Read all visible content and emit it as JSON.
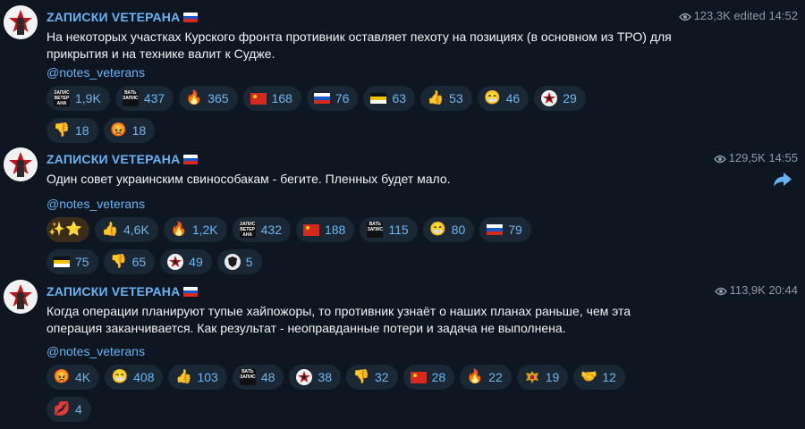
{
  "posts": [
    {
      "channel": "ZАПИСКИ VЕТЕРАНА",
      "views": "123,3K",
      "edited": "edited",
      "time": "14:52",
      "text": "На некоторых участках Курского фронта противник оставляет пехоту на позициях (в основном из ТРО) для прикрытия и на технике валит к Судже.",
      "link": "@notes_veterans",
      "reactions": [
        {
          "icon": "skull-sticker-icon",
          "count": "1,9K"
        },
        {
          "icon": "sticker-text-icon",
          "count": "437"
        },
        {
          "icon": "fire-icon",
          "count": "365"
        },
        {
          "icon": "red-flag-icon",
          "count": "168"
        },
        {
          "icon": "russia-flag-icon",
          "count": "76"
        },
        {
          "icon": "imperial-flag-icon",
          "count": "63"
        },
        {
          "icon": "thumbs-up-icon",
          "count": "53"
        },
        {
          "icon": "grin-icon",
          "count": "46"
        },
        {
          "icon": "star-soldier-icon",
          "count": "29"
        },
        {
          "icon": "thumbs-down-icon",
          "count": "18"
        },
        {
          "icon": "angry-face-icon",
          "count": "18"
        }
      ]
    },
    {
      "channel": "ZАПИСКИ VЕТЕРАНА",
      "views": "129,5K",
      "edited": "",
      "time": "14:55",
      "text": "Один совет украинским свинособакам - бегите. Пленных будет мало.",
      "link": "@notes_veterans",
      "reactions": [
        {
          "icon": "sparkle-star-icon",
          "count": ""
        },
        {
          "icon": "thumbs-up-icon",
          "count": "4,6K"
        },
        {
          "icon": "fire-icon",
          "count": "1,2K"
        },
        {
          "icon": "skull-sticker-icon",
          "count": "432"
        },
        {
          "icon": "red-flag-icon",
          "count": "188"
        },
        {
          "icon": "sticker-text-icon",
          "count": "115"
        },
        {
          "icon": "grin-icon",
          "count": "80"
        },
        {
          "icon": "russia-flag-icon",
          "count": "79"
        },
        {
          "icon": "imperial-flag-icon",
          "count": "75"
        },
        {
          "icon": "thumbs-down-icon",
          "count": "65"
        },
        {
          "icon": "star-soldier-icon",
          "count": "49"
        },
        {
          "icon": "shield-emblem-icon",
          "count": "5"
        }
      ]
    },
    {
      "channel": "ZАПИСКИ VЕТЕРАНА",
      "views": "113,9K",
      "edited": "",
      "time": "20:44",
      "text": "Когда операции планируют тупые хайпожоры, то противник узнаёт о наших планах раньше, чем эта операция заканчивается. Как результат - неоправданные потери и задача не выполнена.",
      "link": "@notes_veterans",
      "reactions": [
        {
          "icon": "angry-face-icon",
          "count": "4K"
        },
        {
          "icon": "grin-icon",
          "count": "408"
        },
        {
          "icon": "thumbs-up-icon",
          "count": "103"
        },
        {
          "icon": "sticker-text-icon",
          "count": "48"
        },
        {
          "icon": "star-soldier-icon",
          "count": "38"
        },
        {
          "icon": "thumbs-down-icon",
          "count": "32"
        },
        {
          "icon": "red-flag-icon",
          "count": "28"
        },
        {
          "icon": "fire-icon",
          "count": "22"
        },
        {
          "icon": "eagle-emblem-icon",
          "count": "19"
        },
        {
          "icon": "handshake-icon",
          "count": "12"
        },
        {
          "icon": "kiss-lips-icon",
          "count": "4"
        }
      ]
    }
  ],
  "colors": {
    "background": "#0e1621",
    "pill": "#1a2836",
    "accent": "#6ab3f3",
    "meta": "#8b9aab"
  }
}
